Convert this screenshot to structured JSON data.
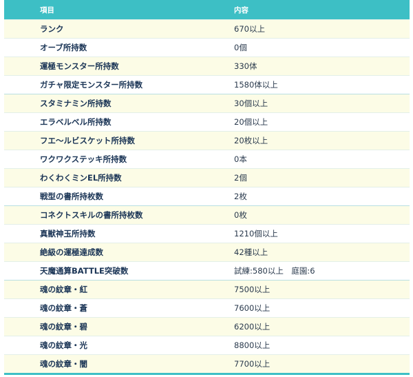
{
  "table": {
    "headers": {
      "item": "項目",
      "content": "内容"
    },
    "rows": [
      {
        "name": "ランク",
        "value": "670以上"
      },
      {
        "name": "オーブ所持数",
        "value": "0個"
      },
      {
        "name": "運極モンスター所持数",
        "value": "330体"
      },
      {
        "name": "ガチャ限定モンスター所持数",
        "value": "1580体以上"
      },
      {
        "name": "スタミナミン所持数",
        "value": "30個以上"
      },
      {
        "name": "エラベルベル所持数",
        "value": "20個以上"
      },
      {
        "name": "フエ～ルビスケット所持数",
        "value": "20枚以上"
      },
      {
        "name": "ワクワクステッキ所持数",
        "value": "0本"
      },
      {
        "name": "わくわくミンEL所持数",
        "value": "2個"
      },
      {
        "name": "戦型の書所持枚数",
        "value": "2枚"
      },
      {
        "name": "コネクトスキルの書所持枚数",
        "value": "0枚"
      },
      {
        "name": "真獣神玉所持数",
        "value": "1210個以上"
      },
      {
        "name": "絶級の運極達成数",
        "value": "42種以上"
      },
      {
        "name": "天魔通算BATTLE突破数",
        "value": "試練:580以上　庭園:6"
      },
      {
        "name": "魂の紋章・紅",
        "value": "7500以上"
      },
      {
        "name": "魂の紋章・蒼",
        "value": "7600以上"
      },
      {
        "name": "魂の紋章・碧",
        "value": "6200以上"
      },
      {
        "name": "魂の紋章・光",
        "value": "8800以上"
      },
      {
        "name": "魂の紋章・闇",
        "value": "7700以上"
      }
    ]
  }
}
